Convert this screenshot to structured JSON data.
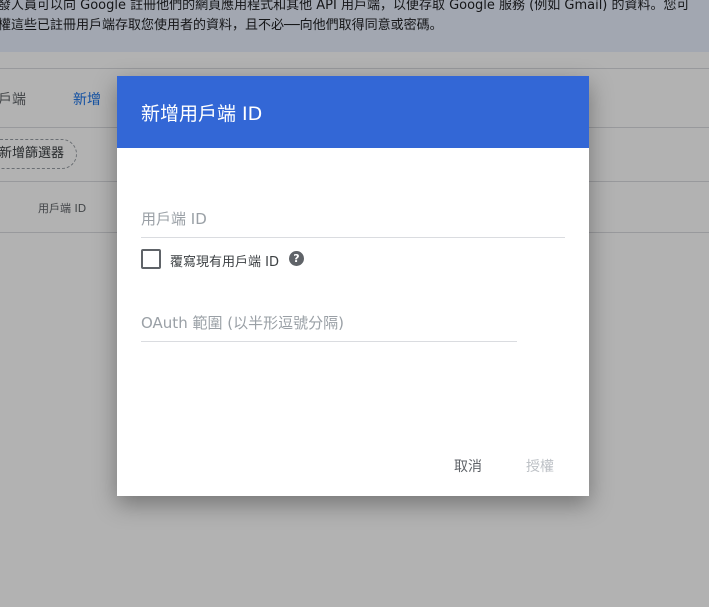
{
  "banner": {
    "line1": "發人員可以向 Google 註冊他們的網頁應用程式和其他 API 用戶端，以便存取 Google 服務 (例如 Gmail) 的資料。您可",
    "line2": "權這些已註冊用戶端存取您使用者的資料，且不必──向他們取得同意或密碼。"
  },
  "tabs": {
    "clients": "戶端",
    "add_new": "新增"
  },
  "filter": {
    "add_filter_label": "新增篩選器"
  },
  "table": {
    "client_id_header": "用戶端 ID"
  },
  "dialog": {
    "title": "新增用戶端 ID",
    "client_id_placeholder": "用戶端 ID",
    "overwrite_label": "覆寫現有用戶端 ID",
    "help_glyph": "?",
    "scope_placeholder": "OAuth 範圍 (以半形逗號分隔)",
    "cancel_label": "取消",
    "authorize_label": "授權"
  },
  "colors": {
    "dialog_header": "#3367d6",
    "link": "#1a73e8",
    "banner_bg": "#e8f0fe"
  }
}
